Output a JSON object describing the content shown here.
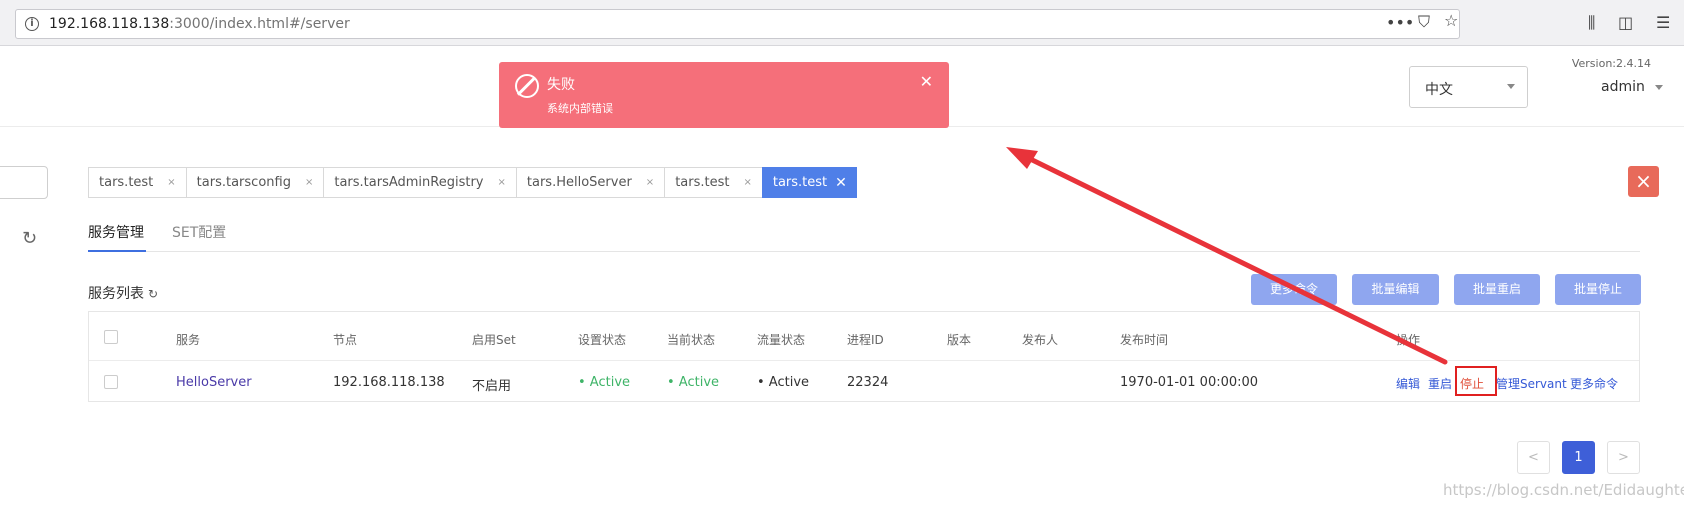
{
  "browser": {
    "url_host": "192.168.118.138",
    "url_rest": ":3000/index.html#/server"
  },
  "header": {
    "version": "Version:2.4.14",
    "language": "中文",
    "user": "admin"
  },
  "notification": {
    "title": "失败",
    "message": "系统内部错误"
  },
  "tabs": [
    {
      "label": "tars.test"
    },
    {
      "label": "tars.tarsconfig"
    },
    {
      "label": "tars.tarsAdminRegistry"
    },
    {
      "label": "tars.HelloServer"
    },
    {
      "label": "tars.test"
    },
    {
      "label": "tars.test",
      "active": true
    }
  ],
  "subtabs": {
    "service": "服务管理",
    "set": "SET配置"
  },
  "list": {
    "title": "服务列表",
    "buttons": {
      "more": "更多命令",
      "batch_edit": "批量编辑",
      "batch_restart": "批量重启",
      "batch_stop": "批量停止"
    },
    "columns": {
      "service": "服务",
      "node": "节点",
      "enable_set": "启用Set",
      "setting_state": "设置状态",
      "current_state": "当前状态",
      "flow_state": "流量状态",
      "pid": "进程ID",
      "version": "版本",
      "publisher": "发布人",
      "publish_time": "发布时间",
      "ops": "操作"
    },
    "rows": [
      {
        "service": "HelloServer",
        "node": "192.168.118.138",
        "enable_set": "不启用",
        "setting_state": "• Active",
        "current_state": "• Active",
        "flow_state": "• Active",
        "pid": "22324",
        "version": "",
        "publisher": "",
        "publish_time": "1970-01-01 00:00:00",
        "ops": {
          "edit": "编辑",
          "restart": "重启",
          "stop": "停止",
          "manage_servant": "管理Servant",
          "more": "更多命令"
        }
      }
    ]
  },
  "pagination": {
    "prev": "<",
    "current": "1",
    "next": ">"
  },
  "watermark": "https://blog.csdn.net/Edidaughter",
  "colors": {
    "error": "#f56f7a",
    "primary": "#3e5fd8",
    "batch_button": "#8fa6ef",
    "active_green": "#3fb468",
    "annotation_red": "#e02020"
  }
}
